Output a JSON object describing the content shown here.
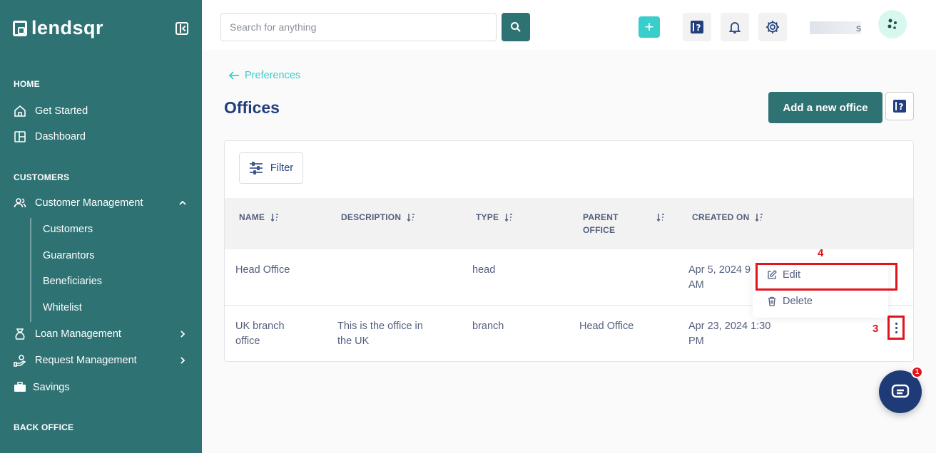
{
  "sidebar": {
    "logo_text": "lendsqr",
    "sections": [
      "HOME",
      "CUSTOMERS",
      "BACK OFFICE"
    ],
    "items": [
      {
        "label": "Get Started",
        "icon": "home-icon"
      },
      {
        "label": "Dashboard",
        "icon": "dashboard-icon"
      },
      {
        "label": "Customer Management",
        "icon": "users-icon",
        "expanded": true
      },
      {
        "label": "Loan Management",
        "icon": "loan-icon"
      },
      {
        "label": "Request Management",
        "icon": "request-icon"
      },
      {
        "label": "Savings",
        "icon": "savings-icon"
      }
    ],
    "sub_items": [
      "Customers",
      "Guarantors",
      "Beneficiaries",
      "Whitelist"
    ]
  },
  "topbar": {
    "search_placeholder": "Search for anything",
    "plus_label": "+",
    "user_name": "s"
  },
  "page": {
    "back_label": "Preferences",
    "title": "Offices",
    "add_button": "Add a new office",
    "filter_label": "Filter"
  },
  "table": {
    "headers": [
      "NAME",
      "DESCRIPTION",
      "TYPE",
      "PARENT OFFICE",
      "CREATED ON"
    ],
    "header_lines": {
      "parent_1": "PARENT",
      "parent_2": "OFFICE"
    },
    "rows": [
      {
        "name": "Head Office",
        "name_2": "",
        "description": "",
        "description_2": "",
        "type": "head",
        "parent": "",
        "created": "Apr 5, 2024 9",
        "created_2": "AM"
      },
      {
        "name": "UK branch",
        "name_2": "office",
        "description": "This is the office in",
        "description_2": "the UK",
        "type": "branch",
        "parent": "Head Office",
        "created": "Apr 23, 2024 1:30",
        "created_2": "PM"
      }
    ]
  },
  "menu": {
    "edit": "Edit",
    "delete": "Delete"
  },
  "annotations": {
    "edit": "4",
    "kebab": "3"
  },
  "chat_badge": "1",
  "colors": {
    "sidebar": "#2f7273",
    "accent": "#39cdcc",
    "primary": "#213f7d",
    "highlight": "#e3131c"
  }
}
